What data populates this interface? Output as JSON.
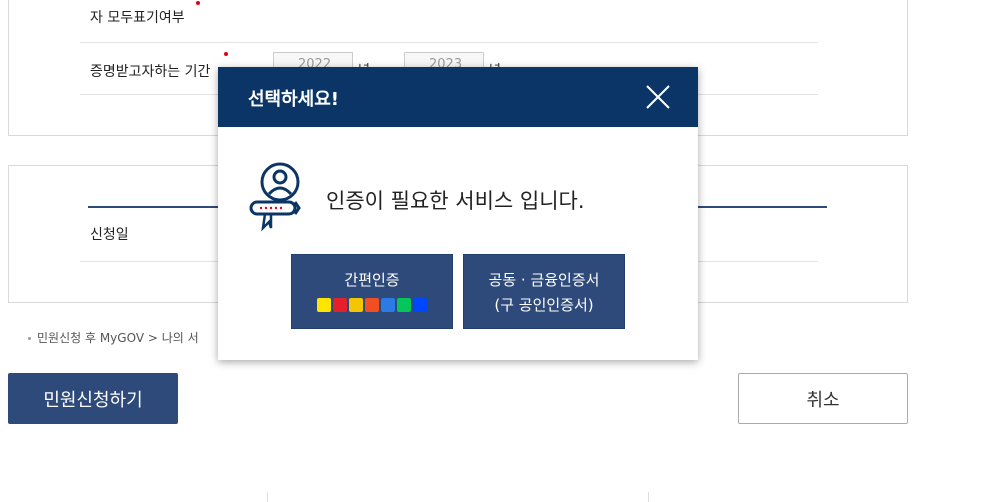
{
  "form": {
    "row1_label": "자 모두표기여부",
    "row2_label": "증명받고자하는 기간",
    "year_from_value": "2022",
    "year_to_value": "2023",
    "year_unit": "년",
    "date_label": "신청일"
  },
  "note": "민원신청 후 MyGOV > 나의 서",
  "buttons": {
    "submit": "민원신청하기",
    "cancel": "취소"
  },
  "modal": {
    "title": "선택하세요!",
    "message": "인증이 필요한 서비스 입니다.",
    "simple_auth_label": "간편인증",
    "cert_label_line1": "공동 · 금융인증서",
    "cert_label_line2": "(구 공인인증서)",
    "provider_icons": [
      "kakao-icon",
      "payco-icon",
      "samsung-pass-icon",
      "kb-icon",
      "pass-icon",
      "naver-icon",
      "shinhan-icon"
    ]
  },
  "colors": {
    "accent": "#2e4a7a",
    "modal_header": "#0b3566",
    "required_dot": "#e0001b"
  }
}
